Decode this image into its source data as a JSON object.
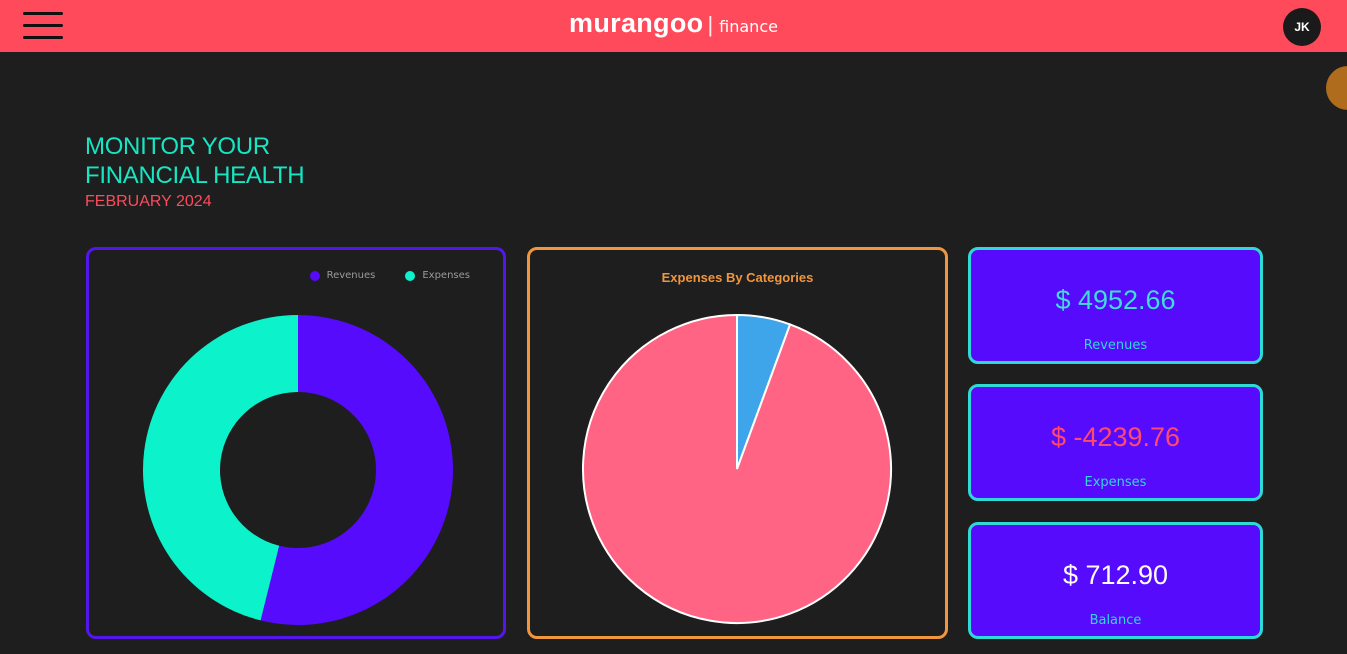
{
  "header": {
    "brand_name": "murangoo",
    "brand_separator": "|",
    "brand_sub": "finance",
    "avatar_initials": "JK",
    "bg_color": "#ff4a5b"
  },
  "hero": {
    "title_line1": "MONITOR YOUR",
    "title_line2": "FINANCIAL HEALTH",
    "period": "FEBRUARY 2024"
  },
  "charts": {
    "donut_legend": [
      {
        "label": "Revenues",
        "color": "#560bfc"
      },
      {
        "label": "Expenses",
        "color": "#0cf3cc"
      }
    ],
    "pie_title": "Expenses By Categories"
  },
  "stats": [
    {
      "value": "$ 4952.66",
      "label": "Revenues",
      "value_color": "#3fdcd8"
    },
    {
      "value": "$ -4239.76",
      "label": "Expenses",
      "value_color": "#ff4a6b"
    },
    {
      "value": "$ 712.90",
      "label": "Balance",
      "value_color": "#ffffff"
    }
  ],
  "chart_data": [
    {
      "type": "pie",
      "title": "",
      "categories": [
        "Revenues",
        "Expenses"
      ],
      "values": [
        4952.66,
        4239.76
      ],
      "colors": [
        "#560bfc",
        "#0cf3cc"
      ],
      "legend": "top-right",
      "donut": true
    },
    {
      "type": "pie",
      "title": "Expenses By Categories",
      "categories": [
        "",
        ""
      ],
      "values": [
        5.6,
        94.4
      ],
      "colors": [
        "#3ea5ea",
        "#ff6484"
      ],
      "legend": "none"
    }
  ]
}
